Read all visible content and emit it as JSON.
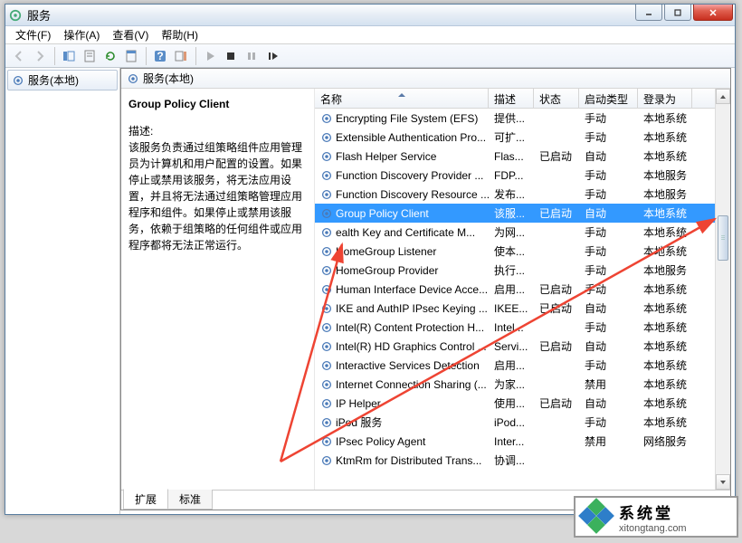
{
  "window": {
    "title": "服务"
  },
  "menu": {
    "file": "文件(F)",
    "action": "操作(A)",
    "view": "查看(V)",
    "help": "帮助(H)"
  },
  "tree": {
    "root": "服务(本地)"
  },
  "header": {
    "title": "服务(本地)"
  },
  "detail": {
    "name": "Group Policy Client",
    "desc_label": "描述:",
    "desc": "该服务负责通过组策略组件应用管理员为计算机和用户配置的设置。如果停止或禁用该服务，将无法应用设置，并且将无法通过组策略管理应用程序和组件。如果停止或禁用该服务，依赖于组策略的任何组件或应用程序都将无法正常运行。"
  },
  "columns": {
    "name": "名称",
    "desc": "描述",
    "status": "状态",
    "startup": "启动类型",
    "logon": "登录为"
  },
  "tabs": {
    "extended": "扩展",
    "standard": "标准"
  },
  "logo": {
    "name": "系统堂",
    "url": "xitongtang.com"
  },
  "rows": [
    {
      "n": "Encrypting File System (EFS)",
      "d": "提供...",
      "s": "",
      "t": "手动",
      "l": "本地系统"
    },
    {
      "n": "Extensible Authentication Pro...",
      "d": "可扩...",
      "s": "",
      "t": "手动",
      "l": "本地系统"
    },
    {
      "n": "Flash Helper Service",
      "d": "Flas...",
      "s": "已启动",
      "t": "自动",
      "l": "本地系统"
    },
    {
      "n": "Function Discovery Provider ...",
      "d": "FDP...",
      "s": "",
      "t": "手动",
      "l": "本地服务"
    },
    {
      "n": "Function Discovery Resource ...",
      "d": "发布...",
      "s": "",
      "t": "手动",
      "l": "本地服务"
    },
    {
      "n": "Group Policy Client",
      "d": "该服...",
      "s": "已启动",
      "t": "自动",
      "l": "本地系统",
      "sel": true
    },
    {
      "n": "ealth Key and Certificate M...",
      "d": "为网...",
      "s": "",
      "t": "手动",
      "l": "本地系统"
    },
    {
      "n": "HomeGroup Listener",
      "d": "使本...",
      "s": "",
      "t": "手动",
      "l": "本地系统"
    },
    {
      "n": "HomeGroup Provider",
      "d": "执行...",
      "s": "",
      "t": "手动",
      "l": "本地服务"
    },
    {
      "n": "Human Interface Device Acce...",
      "d": "启用...",
      "s": "已启动",
      "t": "手动",
      "l": "本地系统"
    },
    {
      "n": "IKE and AuthIP IPsec Keying ...",
      "d": "IKEE...",
      "s": "已启动",
      "t": "自动",
      "l": "本地系统"
    },
    {
      "n": "Intel(R) Content Protection H...",
      "d": "Intel...",
      "s": "",
      "t": "手动",
      "l": "本地系统"
    },
    {
      "n": "Intel(R) HD Graphics Control ...",
      "d": "Servi...",
      "s": "已启动",
      "t": "自动",
      "l": "本地系统"
    },
    {
      "n": "Interactive Services Detection",
      "d": "启用...",
      "s": "",
      "t": "手动",
      "l": "本地系统"
    },
    {
      "n": "Internet Connection Sharing (...",
      "d": "为家...",
      "s": "",
      "t": "禁用",
      "l": "本地系统"
    },
    {
      "n": "IP Helper",
      "d": "使用...",
      "s": "已启动",
      "t": "自动",
      "l": "本地系统"
    },
    {
      "n": "iPod 服务",
      "d": "iPod...",
      "s": "",
      "t": "手动",
      "l": "本地系统"
    },
    {
      "n": "IPsec Policy Agent",
      "d": "Inter...",
      "s": "",
      "t": "禁用",
      "l": "网络服务"
    },
    {
      "n": "KtmRm for Distributed Trans...",
      "d": "协调...",
      "s": "",
      "t": "",
      "l": ""
    }
  ]
}
